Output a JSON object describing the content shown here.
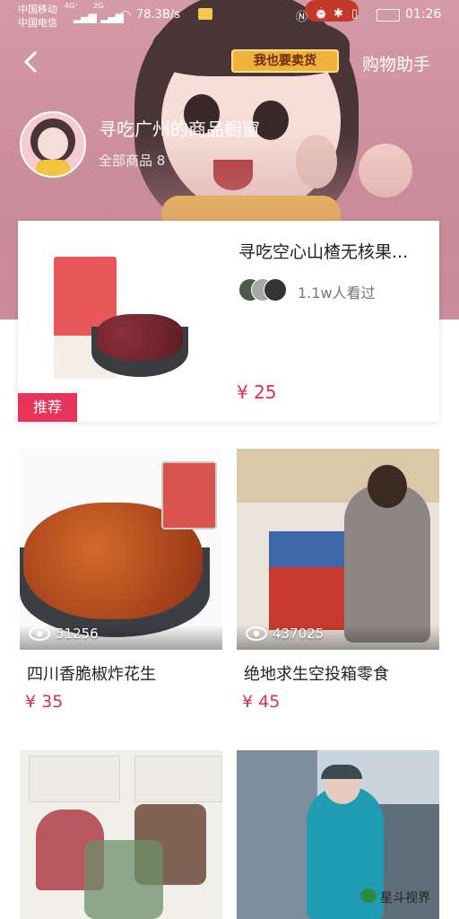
{
  "status_bar": {
    "carrier1": "中国移动",
    "carrier2": "中国电信",
    "signal1": "4G⁺",
    "signal2": "2G",
    "speed": "78.3B/s",
    "time": "01:26"
  },
  "header": {
    "back_icon": "chevron-left-icon",
    "seller_badge": "我也要卖货",
    "assistant_label": "购物助手"
  },
  "store": {
    "name": "寻吃广州的商品橱窗",
    "count_label": "全部商品 8"
  },
  "featured": {
    "title": "寻吃空心山楂无核果...",
    "views": "1.1w人看过",
    "price": "¥ 25",
    "badge": "推荐"
  },
  "products": [
    {
      "title": "四川香脆椒炸花生",
      "views": "51256",
      "price": "¥ 35"
    },
    {
      "title": "绝地求生空投箱零食",
      "views": "437025",
      "price": "¥ 45"
    }
  ],
  "watermark": "星斗视界",
  "colors": {
    "accent": "#e02e4f",
    "badge": "#e6345a",
    "header_bg": "#c98d99"
  }
}
